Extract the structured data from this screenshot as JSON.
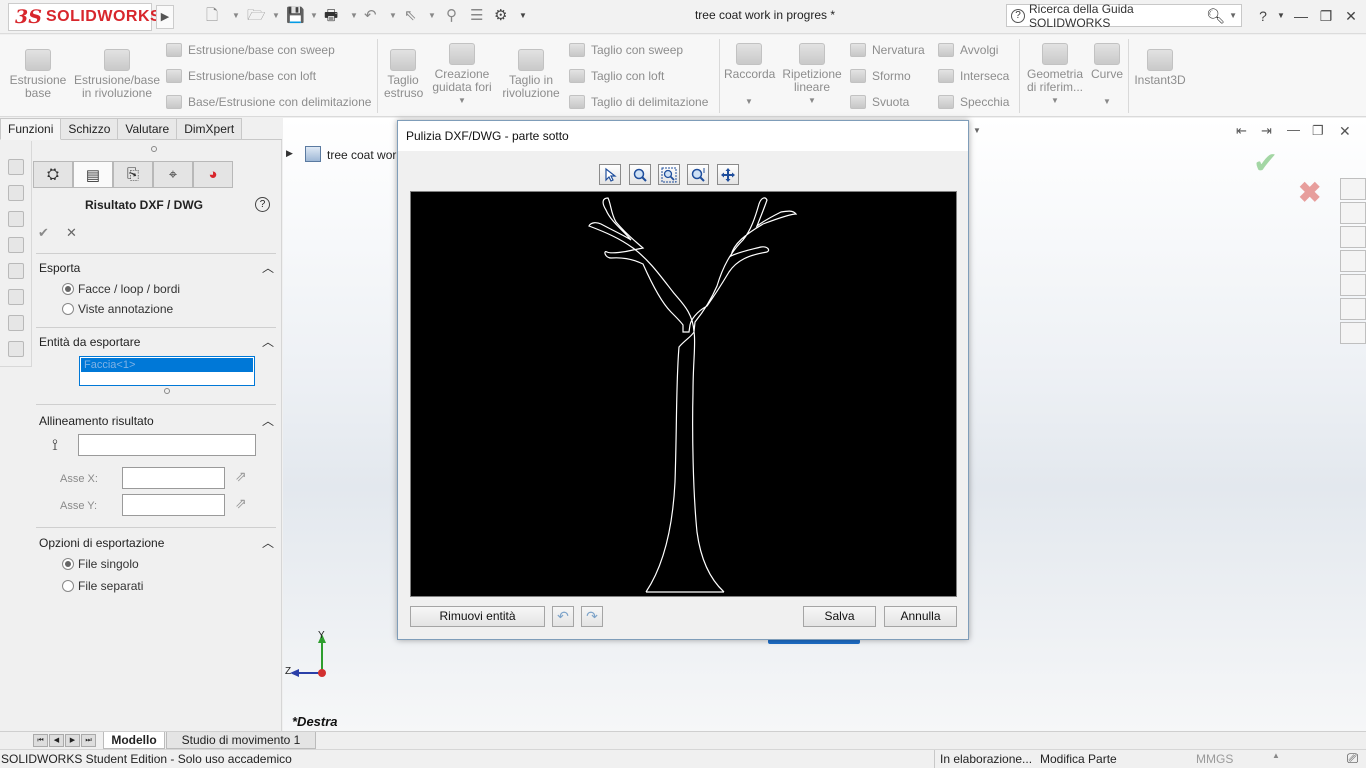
{
  "app": {
    "logo_ds": "3S",
    "logo_text": "SOLIDWORKS",
    "document_title": "tree coat work in progres *",
    "search_placeholder": "Ricerca della Guida SOLIDWORKS",
    "help_label": "?"
  },
  "ribbon": {
    "col1": [
      {
        "label": "Estrusione\nbase",
        "icon": "extrude-boss-icon"
      },
      {
        "label": "Estrusione/base\nin rivoluzione",
        "icon": "revolve-boss-icon"
      }
    ],
    "col2": [
      {
        "label": "Estrusione/base con sweep",
        "icon": "sweep-boss-icon"
      },
      {
        "label": "Estrusione/base con loft",
        "icon": "loft-boss-icon"
      },
      {
        "label": "Base/Estrusione con delimitazione",
        "icon": "boundary-boss-icon"
      }
    ],
    "col3": [
      {
        "label": "Taglio\nestruso",
        "icon": "extrude-cut-icon"
      },
      {
        "label": "Creazione\nguidata fori",
        "icon": "hole-wizard-icon"
      },
      {
        "label": "Taglio in\nrivoluzione",
        "icon": "revolve-cut-icon"
      }
    ],
    "col4": [
      {
        "label": "Taglio con sweep",
        "icon": "sweep-cut-icon"
      },
      {
        "label": "Taglio con loft",
        "icon": "loft-cut-icon"
      },
      {
        "label": "Taglio di delimitazione",
        "icon": "boundary-cut-icon"
      }
    ],
    "col5": [
      {
        "label": "Raccorda",
        "icon": "fillet-icon"
      },
      {
        "label": "Ripetizione\nlineare",
        "icon": "linear-pattern-icon"
      }
    ],
    "col6": [
      {
        "label": "Nervatura",
        "icon": "rib-icon"
      },
      {
        "label": "Sformo",
        "icon": "draft-icon"
      },
      {
        "label": "Svuota",
        "icon": "shell-icon"
      }
    ],
    "col7": [
      {
        "label": "Avvolgi",
        "icon": "wrap-icon"
      },
      {
        "label": "Interseca",
        "icon": "intersect-icon"
      },
      {
        "label": "Specchia",
        "icon": "mirror-icon"
      }
    ],
    "col8": [
      {
        "label": "Geometria\ndi riferim...",
        "icon": "reference-geometry-icon"
      },
      {
        "label": "Curve",
        "icon": "curves-icon"
      },
      {
        "label": "Instant3D",
        "icon": "instant3d-icon"
      }
    ]
  },
  "cm_tabs": [
    "Funzioni",
    "Schizzo",
    "Valutare",
    "DimXpert"
  ],
  "property_manager": {
    "title": "Risultato DXF / DWG",
    "help": "?",
    "ok": "✔",
    "cancel": "✕",
    "export": {
      "header": "Esporta",
      "options": [
        "Facce / loop / bordi",
        "Viste annotazione"
      ],
      "selected": 0
    },
    "entities": {
      "header": "Entità da esportare",
      "item": "Faccia<1>"
    },
    "alignment": {
      "header": "Allineamento risultato",
      "axis_x_label": "Asse X:",
      "axis_y_label": "Asse Y:",
      "origin_value": "",
      "axis_x_value": "",
      "axis_y_value": ""
    },
    "export_options": {
      "header": "Opzioni di esportazione",
      "options": [
        "File singolo",
        "File separati"
      ],
      "selected": 0
    }
  },
  "tree": {
    "root_label": "tree coat wor"
  },
  "viewport": {
    "view_label": "*Destra",
    "axis_y": "Y",
    "axis_z": "Z"
  },
  "dialog": {
    "title": "Pulizia DXF/DWG - parte sotto",
    "remove_button": "Rimuovi entità",
    "save_button": "Salva",
    "cancel_button": "Annulla",
    "undo": "↶",
    "redo": "↷"
  },
  "bottom_tabs": [
    "Modello",
    "Studio di movimento 1"
  ],
  "status": {
    "left": "SOLIDWORKS Student Edition - Solo uso accademico",
    "processing": "In elaborazione...",
    "mode": "Modifica Parte",
    "units": "MMGS"
  },
  "colors": {
    "brand_red": "#d8262c",
    "selection_blue": "#0078d7",
    "accept_green": "#5cb85c",
    "reject_red": "#d9534f"
  }
}
